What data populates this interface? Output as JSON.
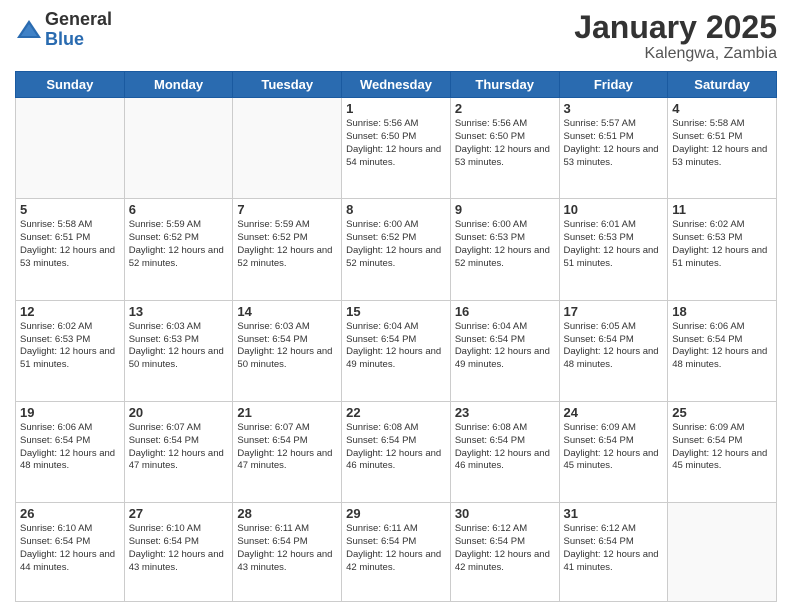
{
  "header": {
    "logo_general": "General",
    "logo_blue": "Blue",
    "month_title": "January 2025",
    "location": "Kalengwa, Zambia"
  },
  "weekdays": [
    "Sunday",
    "Monday",
    "Tuesday",
    "Wednesday",
    "Thursday",
    "Friday",
    "Saturday"
  ],
  "weeks": [
    [
      {
        "day": "",
        "info": ""
      },
      {
        "day": "",
        "info": ""
      },
      {
        "day": "",
        "info": ""
      },
      {
        "day": "1",
        "info": "Sunrise: 5:56 AM\nSunset: 6:50 PM\nDaylight: 12 hours\nand 54 minutes."
      },
      {
        "day": "2",
        "info": "Sunrise: 5:56 AM\nSunset: 6:50 PM\nDaylight: 12 hours\nand 53 minutes."
      },
      {
        "day": "3",
        "info": "Sunrise: 5:57 AM\nSunset: 6:51 PM\nDaylight: 12 hours\nand 53 minutes."
      },
      {
        "day": "4",
        "info": "Sunrise: 5:58 AM\nSunset: 6:51 PM\nDaylight: 12 hours\nand 53 minutes."
      }
    ],
    [
      {
        "day": "5",
        "info": "Sunrise: 5:58 AM\nSunset: 6:51 PM\nDaylight: 12 hours\nand 53 minutes."
      },
      {
        "day": "6",
        "info": "Sunrise: 5:59 AM\nSunset: 6:52 PM\nDaylight: 12 hours\nand 52 minutes."
      },
      {
        "day": "7",
        "info": "Sunrise: 5:59 AM\nSunset: 6:52 PM\nDaylight: 12 hours\nand 52 minutes."
      },
      {
        "day": "8",
        "info": "Sunrise: 6:00 AM\nSunset: 6:52 PM\nDaylight: 12 hours\nand 52 minutes."
      },
      {
        "day": "9",
        "info": "Sunrise: 6:00 AM\nSunset: 6:53 PM\nDaylight: 12 hours\nand 52 minutes."
      },
      {
        "day": "10",
        "info": "Sunrise: 6:01 AM\nSunset: 6:53 PM\nDaylight: 12 hours\nand 51 minutes."
      },
      {
        "day": "11",
        "info": "Sunrise: 6:02 AM\nSunset: 6:53 PM\nDaylight: 12 hours\nand 51 minutes."
      }
    ],
    [
      {
        "day": "12",
        "info": "Sunrise: 6:02 AM\nSunset: 6:53 PM\nDaylight: 12 hours\nand 51 minutes."
      },
      {
        "day": "13",
        "info": "Sunrise: 6:03 AM\nSunset: 6:53 PM\nDaylight: 12 hours\nand 50 minutes."
      },
      {
        "day": "14",
        "info": "Sunrise: 6:03 AM\nSunset: 6:54 PM\nDaylight: 12 hours\nand 50 minutes."
      },
      {
        "day": "15",
        "info": "Sunrise: 6:04 AM\nSunset: 6:54 PM\nDaylight: 12 hours\nand 49 minutes."
      },
      {
        "day": "16",
        "info": "Sunrise: 6:04 AM\nSunset: 6:54 PM\nDaylight: 12 hours\nand 49 minutes."
      },
      {
        "day": "17",
        "info": "Sunrise: 6:05 AM\nSunset: 6:54 PM\nDaylight: 12 hours\nand 48 minutes."
      },
      {
        "day": "18",
        "info": "Sunrise: 6:06 AM\nSunset: 6:54 PM\nDaylight: 12 hours\nand 48 minutes."
      }
    ],
    [
      {
        "day": "19",
        "info": "Sunrise: 6:06 AM\nSunset: 6:54 PM\nDaylight: 12 hours\nand 48 minutes."
      },
      {
        "day": "20",
        "info": "Sunrise: 6:07 AM\nSunset: 6:54 PM\nDaylight: 12 hours\nand 47 minutes."
      },
      {
        "day": "21",
        "info": "Sunrise: 6:07 AM\nSunset: 6:54 PM\nDaylight: 12 hours\nand 47 minutes."
      },
      {
        "day": "22",
        "info": "Sunrise: 6:08 AM\nSunset: 6:54 PM\nDaylight: 12 hours\nand 46 minutes."
      },
      {
        "day": "23",
        "info": "Sunrise: 6:08 AM\nSunset: 6:54 PM\nDaylight: 12 hours\nand 46 minutes."
      },
      {
        "day": "24",
        "info": "Sunrise: 6:09 AM\nSunset: 6:54 PM\nDaylight: 12 hours\nand 45 minutes."
      },
      {
        "day": "25",
        "info": "Sunrise: 6:09 AM\nSunset: 6:54 PM\nDaylight: 12 hours\nand 45 minutes."
      }
    ],
    [
      {
        "day": "26",
        "info": "Sunrise: 6:10 AM\nSunset: 6:54 PM\nDaylight: 12 hours\nand 44 minutes."
      },
      {
        "day": "27",
        "info": "Sunrise: 6:10 AM\nSunset: 6:54 PM\nDaylight: 12 hours\nand 43 minutes."
      },
      {
        "day": "28",
        "info": "Sunrise: 6:11 AM\nSunset: 6:54 PM\nDaylight: 12 hours\nand 43 minutes."
      },
      {
        "day": "29",
        "info": "Sunrise: 6:11 AM\nSunset: 6:54 PM\nDaylight: 12 hours\nand 42 minutes."
      },
      {
        "day": "30",
        "info": "Sunrise: 6:12 AM\nSunset: 6:54 PM\nDaylight: 12 hours\nand 42 minutes."
      },
      {
        "day": "31",
        "info": "Sunrise: 6:12 AM\nSunset: 6:54 PM\nDaylight: 12 hours\nand 41 minutes."
      },
      {
        "day": "",
        "info": ""
      }
    ]
  ]
}
